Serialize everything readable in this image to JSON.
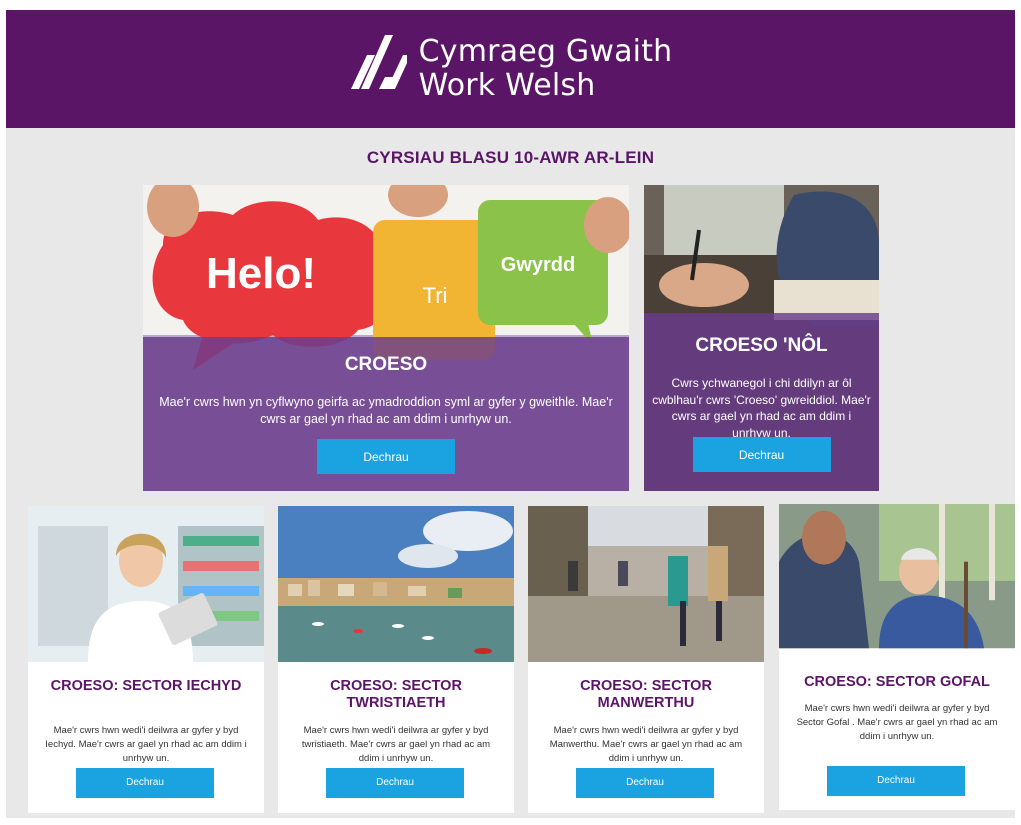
{
  "header": {
    "logo_line1": "Cymraeg Gwaith",
    "logo_line2": "Work Welsh"
  },
  "section_title": "CYRSIAU BLASU 10-AWR AR-LEIN",
  "featured": [
    {
      "bubbles": [
        "Helo!",
        "Tri",
        "Gwyrdd"
      ],
      "title": "CROESO",
      "description": "Mae'r cwrs hwn yn cyflwyno geirfa ac ymadroddion syml ar gyfer y gweithle. Mae'r cwrs ar gael yn rhad ac am ddim i unrhyw un.",
      "button": "Dechrau"
    },
    {
      "title": "CROESO 'NÔL",
      "description": "Cwrs ychwanegol i chi ddilyn ar ôl cwblhau'r cwrs 'Croeso' gwreiddiol. Mae'r cwrs ar gael yn rhad ac am ddim i unrhyw un.",
      "button": "Dechrau"
    }
  ],
  "cards": [
    {
      "title": "CROESO: SECTOR IECHYD",
      "description": "Mae'r cwrs hwn wedi'i deilwra ar gyfer y byd Iechyd. Mae'r cwrs ar gael yn rhad ac am ddim i unrhyw un.",
      "button": "Dechrau"
    },
    {
      "title": "CROESO: SECTOR TWRISTIAETH",
      "description": "Mae'r cwrs hwn wedi'i deilwra ar gyfer y byd twristiaeth. Mae'r cwrs ar gael yn rhad ac am ddim i unrhyw un.",
      "button": "Dechrau"
    },
    {
      "title": "CROESO: SECTOR MANWERTHU",
      "description": "Mae'r cwrs hwn wedi'i deilwra ar gyfer y byd Manwerthu. Mae'r cwrs ar gael yn rhad ac am ddim i unrhyw un.",
      "button": "Dechrau"
    },
    {
      "title": "CROESO: SECTOR GOFAL",
      "description": "Mae'r cwrs hwn wedi'i deilwra ar gyfer y byd Sector Gofal . Mae'r cwrs ar gael yn rhad ac am ddim i unrhyw un.",
      "button": "Dechrau"
    }
  ],
  "colors": {
    "brand_purple": "#5a1567",
    "button_blue": "#1aa3e0",
    "page_bg": "#e8e8e8"
  }
}
